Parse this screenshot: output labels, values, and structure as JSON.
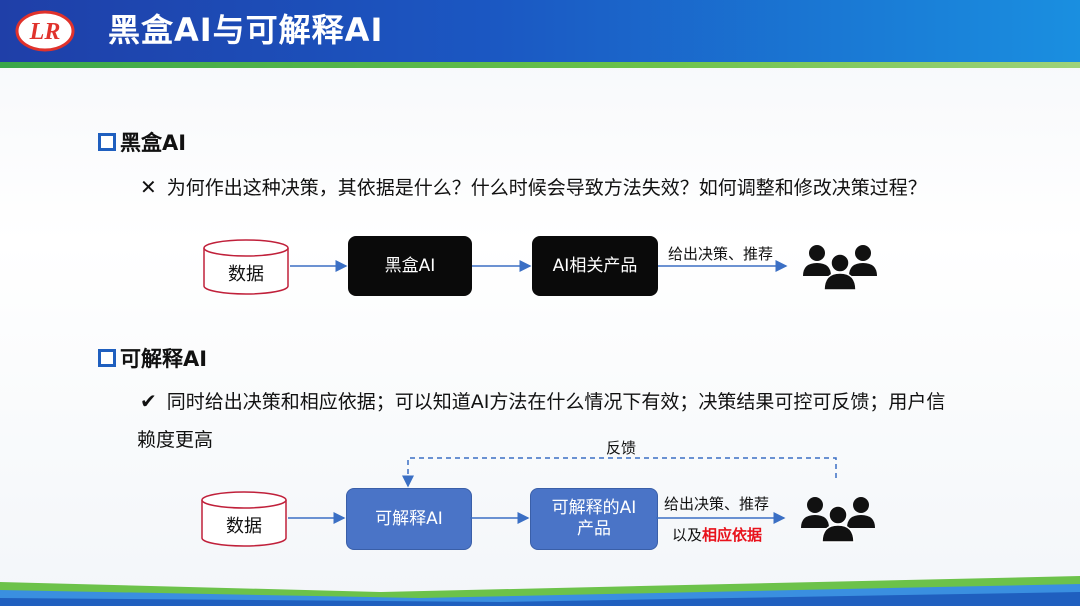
{
  "header": {
    "title": "黑盒AI与可解释AI",
    "logo_text": "LR",
    "bg_color": "#1b57c2",
    "stripe_color": "#3aa64a"
  },
  "blackbox": {
    "heading": "黑盒AI",
    "mark_icon": "x-mark-icon",
    "mark": "✕",
    "text": "为何作出这种决策，其依据是什么？什么时候会导致方法失效？如何调整和修改决策过程？",
    "flow": {
      "data_label": "数据",
      "model_label": "黑盒AI",
      "product_label": "AI相关产品",
      "output_label": "给出决策、推荐"
    }
  },
  "explainable": {
    "heading": "可解释AI",
    "mark_icon": "check-mark-icon",
    "mark": "✔",
    "text_line1": "同时给出决策和相应依据；可以知道AI方法在什么情况下有效；决策结果可控可反馈；用户信",
    "text_line2": "赖度更高",
    "flow": {
      "feedback_label": "反馈",
      "data_label": "数据",
      "model_label": "可解释AI",
      "product_label_line1": "可解释的AI",
      "product_label_line2": "产品",
      "output_label": "给出决策、推荐",
      "output_prefix": "以及",
      "output_highlight": "相应依据"
    }
  },
  "colors": {
    "accent_blue": "#4a74c7",
    "highlight_red": "#e8121b",
    "arrow_blue": "#3b6fc4"
  }
}
